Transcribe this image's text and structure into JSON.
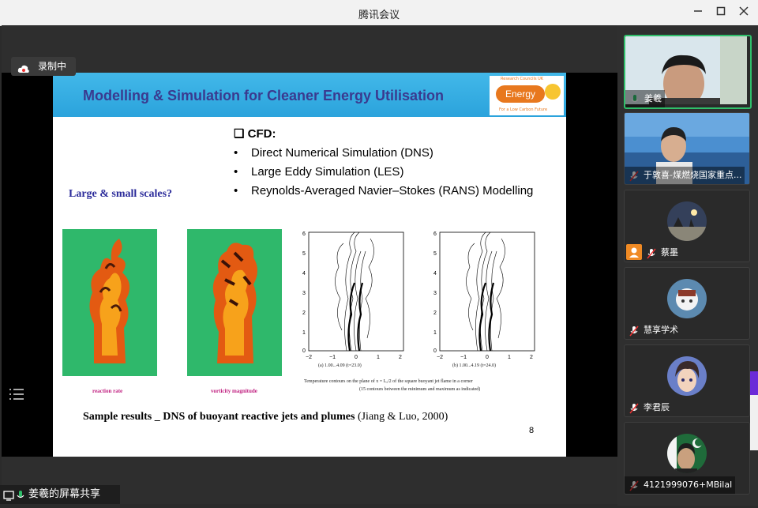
{
  "window": {
    "title": "腾讯会议",
    "minimize_icon": "minimize-icon",
    "maximize_icon": "maximize-icon",
    "close_icon": "close-icon"
  },
  "recording": {
    "label": "录制中",
    "icon": "cloud-record-icon"
  },
  "share_status": {
    "label": "姜羲的屏幕共享"
  },
  "slide": {
    "title": "Modelling & Simulation for Cleaner Energy Utilisation",
    "logo": {
      "word": "Energy",
      "top_text": "Research Councils UK",
      "bottom_text": "For a Low Carbon Future"
    },
    "cfd_heading": "❑ CFD:",
    "bullets": [
      "Direct Numerical Simulation (DNS)",
      "Large Eddy Simulation (LES)",
      "Reynolds-Averaged Navier–Stokes (RANS) Modelling"
    ],
    "scales_question": "Large & small scales?",
    "image_captions": [
      "reaction rate",
      "vorticity magnitude"
    ],
    "plot_captions": [
      "(a) 1.00...4.09 (t=23.0)",
      "(b) 1.00...4.19 (t=24.0)"
    ],
    "plot_footnote_1": "Temperature contours on the plane of x = Lₓ/2 of the square buoyant jet flame in a corner",
    "plot_footnote_2": "(15 contours between the minimum and maximum as indicated)",
    "sample_bold": "Sample results _ DNS of buoyant reactive jets and plumes",
    "sample_rest": " (Jiang & Luo, 2000)",
    "page_number": "8"
  },
  "participants": [
    {
      "name": "姜羲",
      "mic": "mic-on"
    },
    {
      "name": "于敦喜-煤燃烧国家重点...",
      "mic": "mic-muted"
    },
    {
      "name": "蔡墨",
      "mic": "mic-muted"
    },
    {
      "name": "慧享学术",
      "mic": "mic-muted"
    },
    {
      "name": "李君辰",
      "mic": "mic-muted"
    },
    {
      "name": "4121999076+MBilal",
      "mic": "mic-muted"
    }
  ],
  "colors": {
    "active_speaker": "#2fbf6a",
    "banner": "#2ba3dc",
    "title_text": "#3a3a8f"
  }
}
